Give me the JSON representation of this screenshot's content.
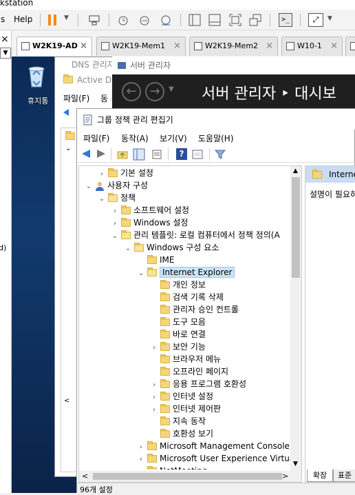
{
  "vmware": {
    "title_fragment": "kstation",
    "menu_partial_left": "s",
    "menu_help": "Help",
    "side_close": "×",
    "tabs": [
      {
        "label": "W2K19-AD",
        "active": true
      },
      {
        "label": "W2K19-Mem1",
        "active": false
      },
      {
        "label": "W2K19-Mem2",
        "active": false
      },
      {
        "label": "W10-1",
        "active": false
      }
    ],
    "left_fragment_d": "d)"
  },
  "desktop": {
    "recycle_label": "휴지통"
  },
  "dns_window": {
    "title": "DNS 관리자",
    "active_dir_title": "Active Di",
    "menu_file": "파일(F)",
    "menu_action_partial": "동"
  },
  "server_manager": {
    "title": "서버 관리자",
    "breadcrumb": "서버 관리자 ‣ 대시보"
  },
  "gpe": {
    "title": "그룹 정책 관리 편집기",
    "menu": [
      "파일(F)",
      "동작(A)",
      "보기(V)",
      "도움말(H)"
    ],
    "tree": [
      {
        "level": 2,
        "exp": "›",
        "label": "기본 설정"
      },
      {
        "level": 1,
        "exp": "⌄",
        "label": "사용자 구성",
        "icon": "user"
      },
      {
        "level": 2,
        "exp": "⌄",
        "label": "정책"
      },
      {
        "level": 3,
        "exp": "›",
        "label": "소프트웨어 설정"
      },
      {
        "level": 3,
        "exp": "›",
        "label": "Windows 설정"
      },
      {
        "level": 3,
        "exp": "⌄",
        "label": "관리 템플릿: 로컬 컴퓨터에서 정책 정의(A"
      },
      {
        "level": 4,
        "exp": "⌄",
        "label": "Windows 구성 요소"
      },
      {
        "level": 5,
        "exp": "",
        "label": "IME"
      },
      {
        "level": 5,
        "exp": "⌄",
        "label": "Internet Explorer",
        "selected": true
      },
      {
        "level": 6,
        "exp": "",
        "label": "개인 정보"
      },
      {
        "level": 6,
        "exp": "",
        "label": "검색 기록 삭제"
      },
      {
        "level": 6,
        "exp": "",
        "label": "관리자 승인 컨트롤"
      },
      {
        "level": 6,
        "exp": "",
        "label": "도구 모음"
      },
      {
        "level": 6,
        "exp": "",
        "label": "바로 연결"
      },
      {
        "level": 6,
        "exp": "›",
        "label": "보안 기능"
      },
      {
        "level": 6,
        "exp": "",
        "label": "브라우저 메뉴"
      },
      {
        "level": 6,
        "exp": "",
        "label": "오프라인 페이지"
      },
      {
        "level": 6,
        "exp": "›",
        "label": "응용 프로그램 호환성"
      },
      {
        "level": 6,
        "exp": "›",
        "label": "인터넷 설정"
      },
      {
        "level": 6,
        "exp": "›",
        "label": "인터넷 제어판"
      },
      {
        "level": 6,
        "exp": "",
        "label": "지속 동작"
      },
      {
        "level": 6,
        "exp": "",
        "label": "호환성 보기"
      },
      {
        "level": 5,
        "exp": "›",
        "label": "Microsoft Management Console"
      },
      {
        "level": 5,
        "exp": "›",
        "label": "Microsoft User Experience Virtualiz"
      },
      {
        "level": 5,
        "exp": "",
        "label": "NetMeeting"
      }
    ],
    "right_header": "Interne",
    "right_desc": "설명이 필요하",
    "bottom_tabs": [
      "확장",
      "표준"
    ],
    "status": "96개 설정"
  }
}
